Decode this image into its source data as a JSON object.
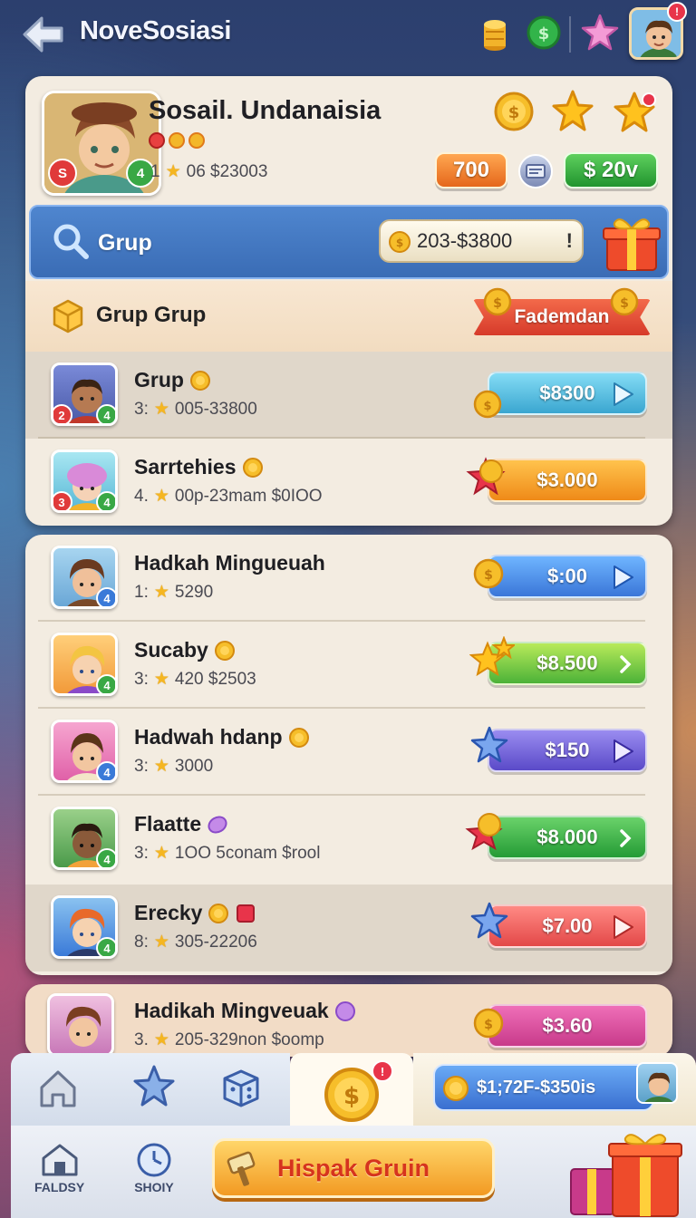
{
  "header": {
    "title": "NoveSosiasi",
    "notification_count": "!"
  },
  "profile": {
    "name": "Sosail. Undanaisia",
    "stats_prefix": "1",
    "stats_value": "06 $23003",
    "level": "4",
    "pill_orange": "700",
    "pill_green": "$ 20v"
  },
  "search": {
    "label": "Grup",
    "value": "203-$3800",
    "bang": "!"
  },
  "group": {
    "title": "Grup Grup",
    "ribbon_label": "Fademdan"
  },
  "rows": [
    {
      "name": "Grup",
      "meta_prefix": "3:",
      "meta": "005-33800",
      "price": "$8300",
      "lvl_left": "2",
      "lvl_right": "4"
    },
    {
      "name": "Sarrtehies",
      "meta_prefix": "4.",
      "meta": "00p-23mam $0ΙΟΟ",
      "price": "$3.000",
      "lvl_left": "3",
      "lvl_right": "4"
    },
    {
      "name": "Hadkah Mingueuah",
      "meta_prefix": "1:",
      "meta": "5290",
      "price": "$:00",
      "lvl_left": "",
      "lvl_right": "4"
    },
    {
      "name": "Sucaby",
      "meta_prefix": "3:",
      "meta": "420 $2503",
      "price": "$8.500",
      "lvl_left": "",
      "lvl_right": "4"
    },
    {
      "name": "Hadwah hdanp",
      "meta_prefix": "3:",
      "meta": "3000",
      "price": "$150",
      "lvl_left": "",
      "lvl_right": "4"
    },
    {
      "name": "Flaatte",
      "meta_prefix": "3:",
      "meta": "1ΟΟ 5conam $rool",
      "price": "$8.000",
      "lvl_left": "",
      "lvl_right": "4"
    },
    {
      "name": "Erecky",
      "meta_prefix": "8:",
      "meta": "305-22206",
      "price": "$7.00",
      "lvl_left": "",
      "lvl_right": "4"
    },
    {
      "name": "Hadikah Mingveuak",
      "meta_prefix": "3.",
      "meta": "205-329non $oomp",
      "price": "$3.60",
      "lvl_left": "",
      "lvl_right": "4"
    }
  ],
  "bottom_nav": {
    "balance": "$1;72F-$350is",
    "item_left_label": "FALDSY",
    "item_mid_label": "SHOIY",
    "action_button": "Hispak Gruin",
    "coin_badge": "!"
  },
  "colors": {
    "accent_blue": "#3a6cb5",
    "coin_gold": "#f3b72a",
    "action_orange": "#f29a22"
  }
}
